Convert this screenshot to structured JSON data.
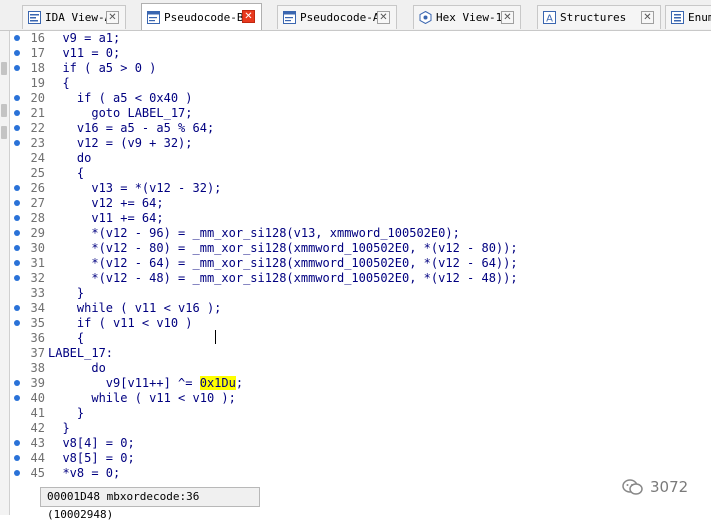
{
  "tabs": [
    {
      "label": "IDA View-A",
      "icon": "ida-view-icon",
      "active": false
    },
    {
      "label": "Pseudocode-B",
      "icon": "pseudocode-icon",
      "active": true
    },
    {
      "label": "Pseudocode-A",
      "icon": "pseudocode-icon",
      "active": false
    },
    {
      "label": "Hex View-1",
      "icon": "hex-view-icon",
      "active": false
    },
    {
      "label": "Structures",
      "icon": "structures-icon",
      "active": false
    },
    {
      "label": "Enum",
      "icon": "enums-icon",
      "active": false
    }
  ],
  "code_lines": [
    {
      "num": "16",
      "bp": true,
      "text": "  v9 = a1;"
    },
    {
      "num": "17",
      "bp": true,
      "text": "  v11 = 0;"
    },
    {
      "num": "18",
      "bp": true,
      "text": "  if ( a5 > 0 )"
    },
    {
      "num": "19",
      "bp": false,
      "text": "  {"
    },
    {
      "num": "20",
      "bp": true,
      "text": "    if ( a5 < 0x40 )"
    },
    {
      "num": "21",
      "bp": true,
      "text": "      goto LABEL_17;"
    },
    {
      "num": "22",
      "bp": true,
      "text": "    v16 = a5 - a5 % 64;"
    },
    {
      "num": "23",
      "bp": true,
      "text": "    v12 = (v9 + 32);"
    },
    {
      "num": "24",
      "bp": false,
      "text": "    do"
    },
    {
      "num": "25",
      "bp": false,
      "text": "    {"
    },
    {
      "num": "26",
      "bp": true,
      "text": "      v13 = *(v12 - 32);"
    },
    {
      "num": "27",
      "bp": true,
      "text": "      v12 += 64;"
    },
    {
      "num": "28",
      "bp": true,
      "text": "      v11 += 64;"
    },
    {
      "num": "29",
      "bp": true,
      "text": "      *(v12 - 96) = _mm_xor_si128(v13, xmmword_100502E0);"
    },
    {
      "num": "30",
      "bp": true,
      "text": "      *(v12 - 80) = _mm_xor_si128(xmmword_100502E0, *(v12 - 80));"
    },
    {
      "num": "31",
      "bp": true,
      "text": "      *(v12 - 64) = _mm_xor_si128(xmmword_100502E0, *(v12 - 64));"
    },
    {
      "num": "32",
      "bp": true,
      "text": "      *(v12 - 48) = _mm_xor_si128(xmmword_100502E0, *(v12 - 48));"
    },
    {
      "num": "33",
      "bp": false,
      "text": "    }"
    },
    {
      "num": "34",
      "bp": true,
      "text": "    while ( v11 < v16 );"
    },
    {
      "num": "35",
      "bp": true,
      "text": "    if ( v11 < v10 )"
    },
    {
      "num": "36",
      "bp": false,
      "text": "    {"
    },
    {
      "num": "37",
      "bp": false,
      "text": "LABEL_17:"
    },
    {
      "num": "38",
      "bp": false,
      "text": "      do"
    },
    {
      "num": "39",
      "bp": true,
      "text": "        v9[v11++] ^= ",
      "highlight": "0x1Du",
      "tail": ";"
    },
    {
      "num": "40",
      "bp": true,
      "text": "      while ( v11 < v10 );"
    },
    {
      "num": "41",
      "bp": false,
      "text": "    }"
    },
    {
      "num": "42",
      "bp": false,
      "text": "  }"
    },
    {
      "num": "43",
      "bp": true,
      "text": "  v8[4] = 0;"
    },
    {
      "num": "44",
      "bp": true,
      "text": "  v8[5] = 0;"
    },
    {
      "num": "45",
      "bp": true,
      "text": "  *v8 = 0;"
    }
  ],
  "status": {
    "text": "00001D48 mbxordecode:36 (10002948)"
  },
  "watermark": {
    "text": "3072"
  },
  "colors": {
    "breakpoint": "#2a72d8",
    "highlight": "#ffff00",
    "active_close": "#e8391e",
    "code": "#000080"
  }
}
